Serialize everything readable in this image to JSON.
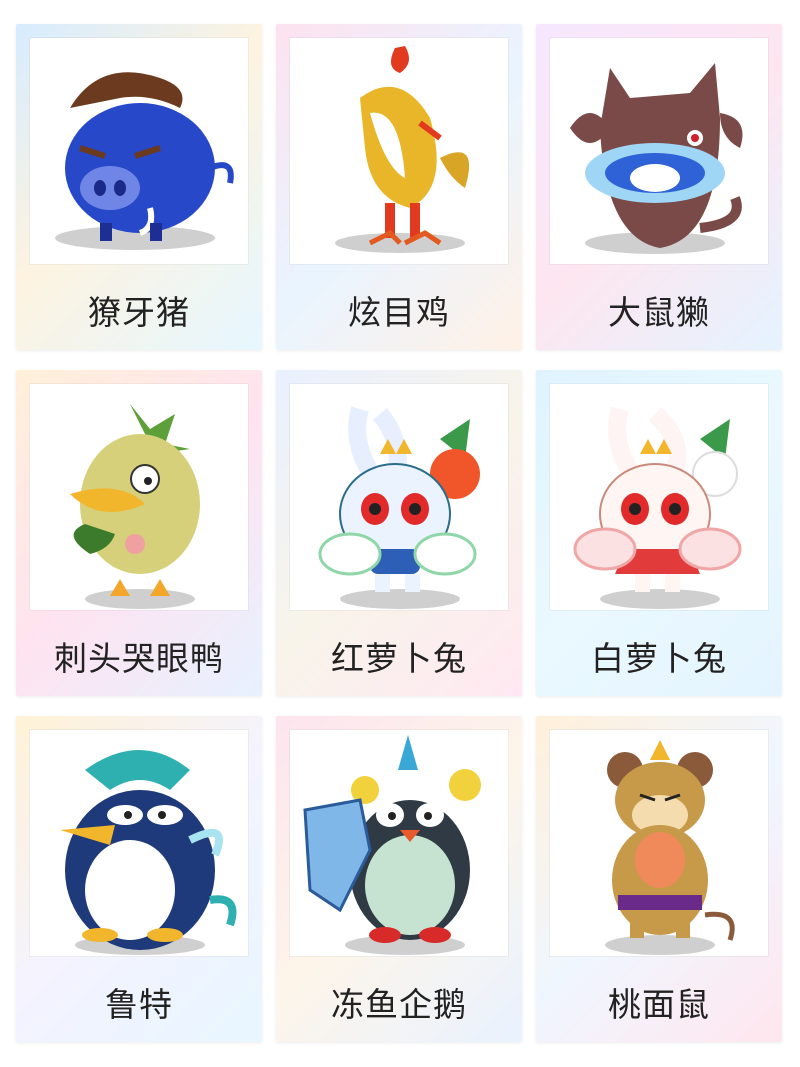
{
  "cards": [
    {
      "name": "獠牙猪"
    },
    {
      "name": "炫目鸡"
    },
    {
      "name": "大鼠獭"
    },
    {
      "name": "刺头哭眼鸭"
    },
    {
      "name": "红萝卜兔"
    },
    {
      "name": "白萝卜兔"
    },
    {
      "name": "鲁特"
    },
    {
      "name": "冻鱼企鹅"
    },
    {
      "name": "桃面鼠"
    }
  ]
}
